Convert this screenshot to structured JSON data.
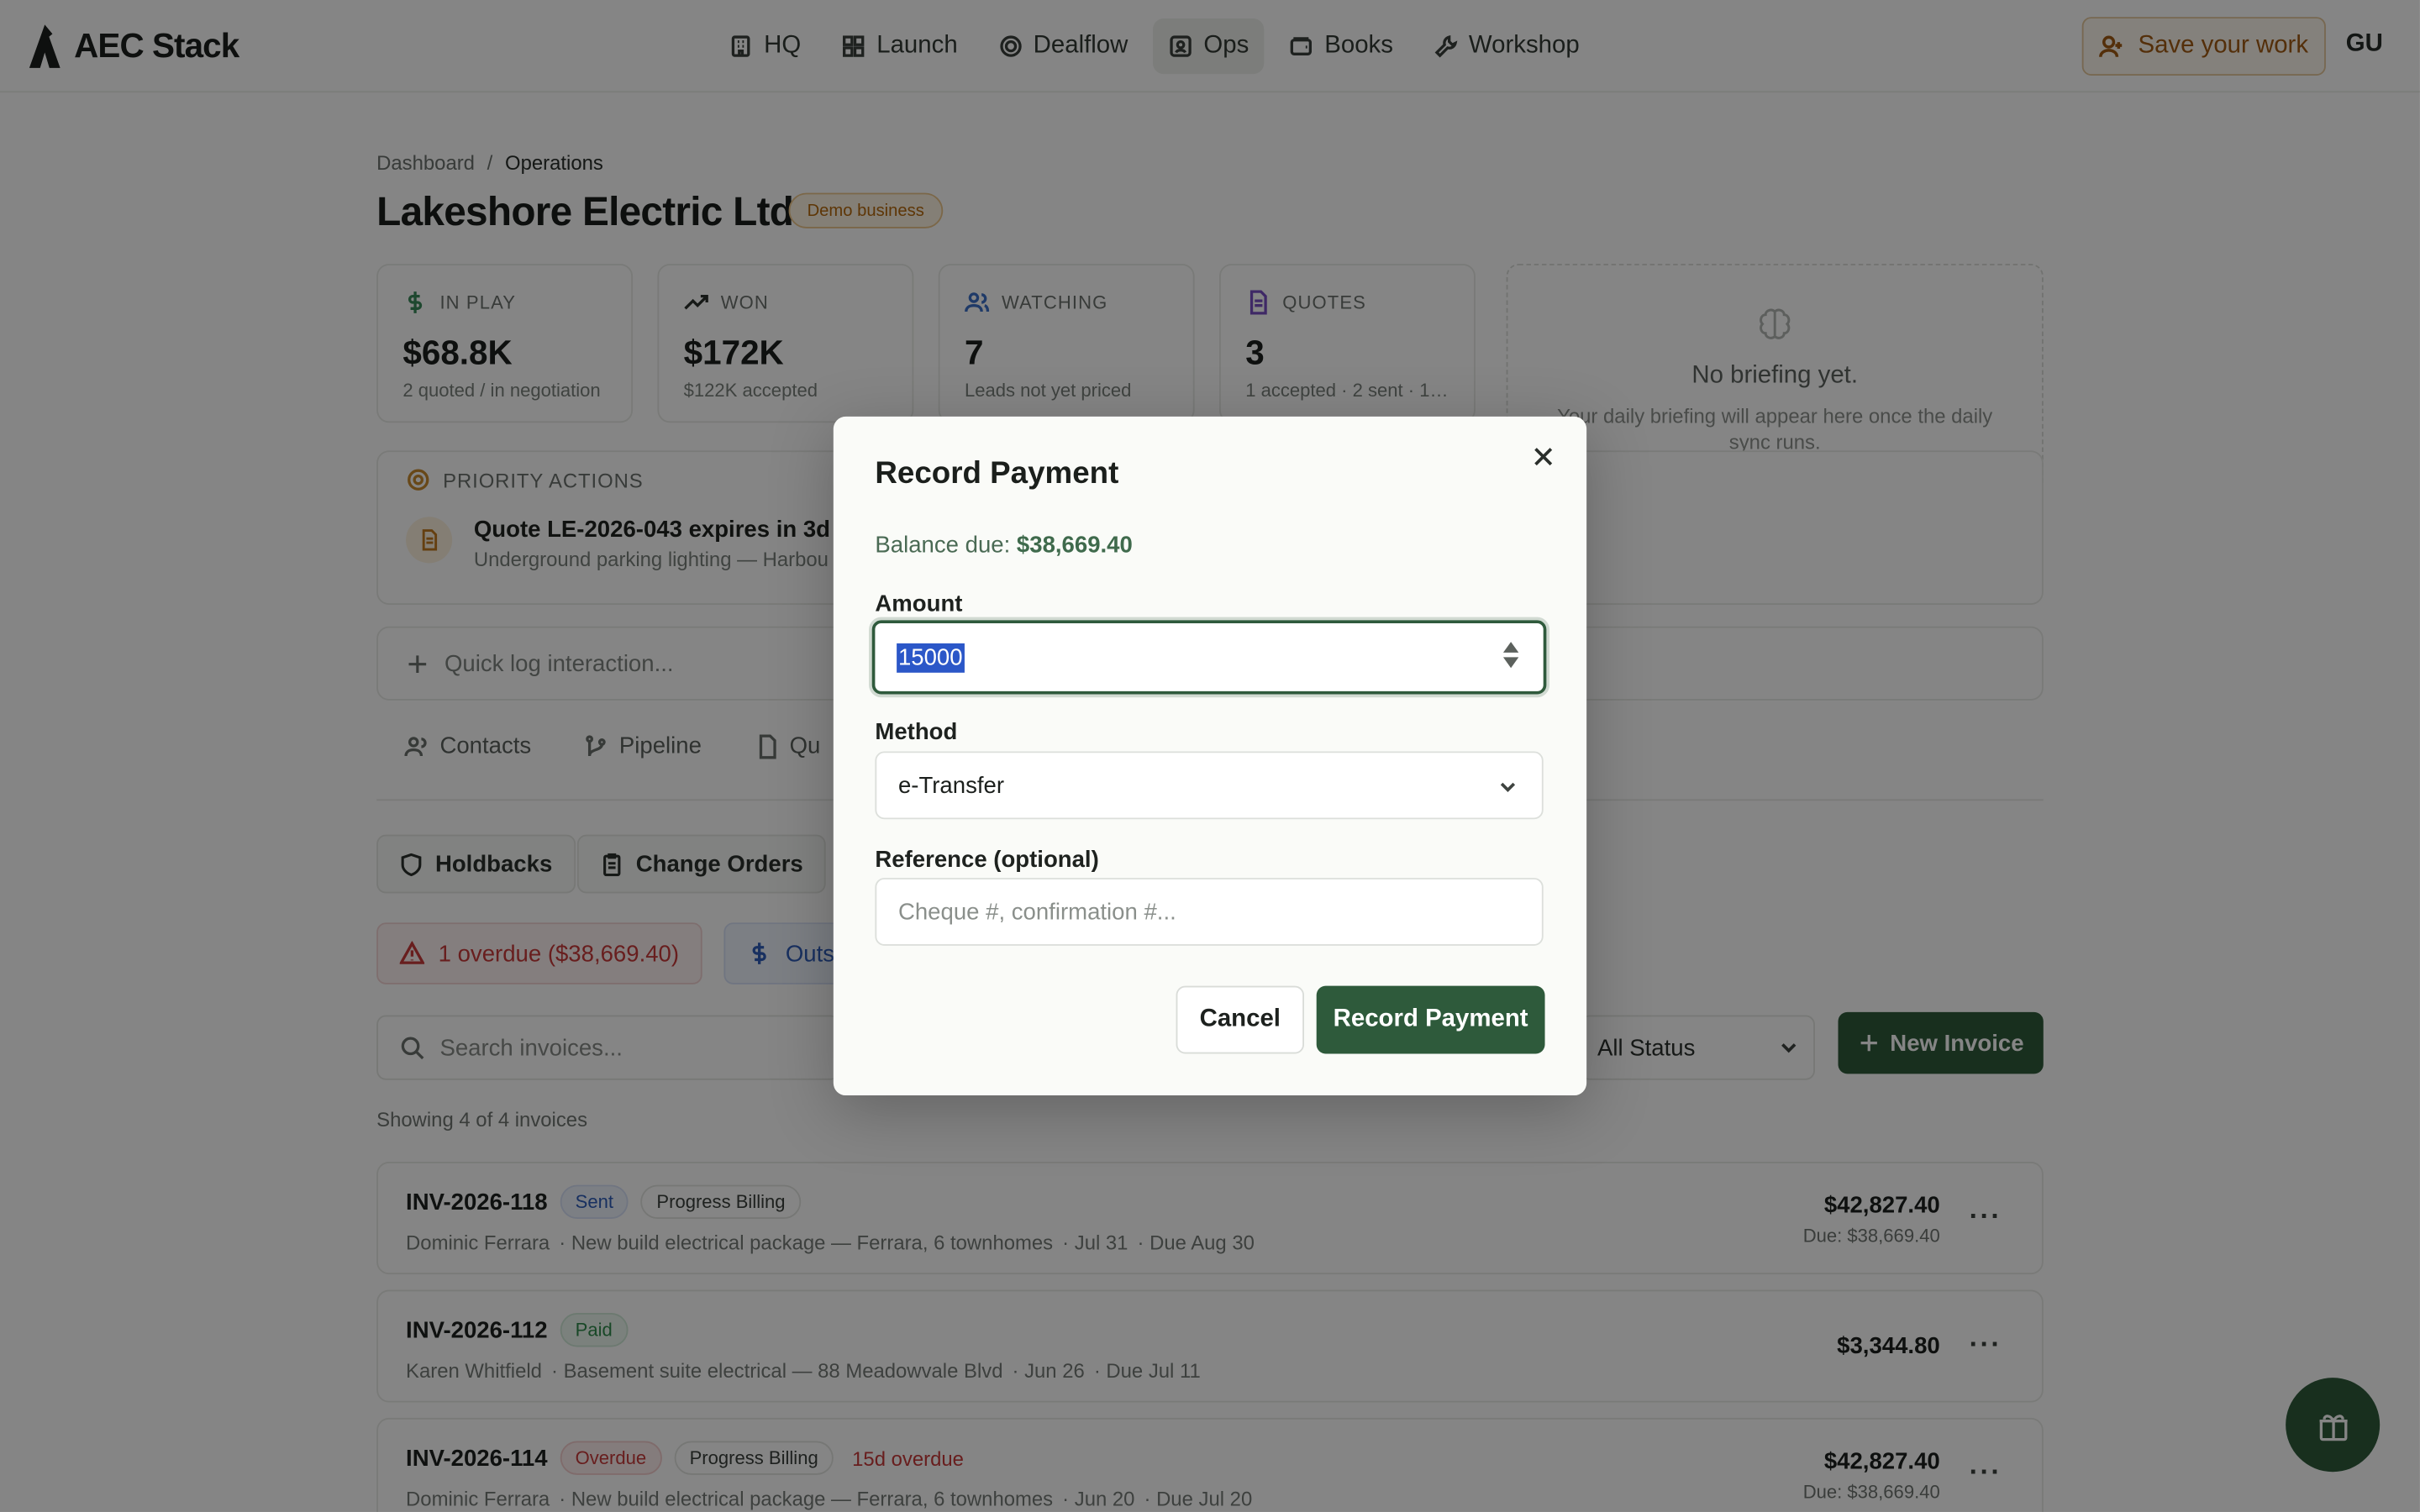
{
  "header": {
    "logo_text": "AEC Stack",
    "nav": [
      {
        "label": "HQ",
        "icon": "building-icon"
      },
      {
        "label": "Launch",
        "icon": "grid-icon"
      },
      {
        "label": "Dealflow",
        "icon": "target-icon"
      },
      {
        "label": "Ops",
        "icon": "contact-icon",
        "active": true
      },
      {
        "label": "Books",
        "icon": "wallet-icon"
      },
      {
        "label": "Workshop",
        "icon": "wrench-icon"
      }
    ],
    "save_label": "Save your work",
    "avatar_initials": "GU"
  },
  "breadcrumb": {
    "root": "Dashboard",
    "separator": "/",
    "current": "Operations"
  },
  "page": {
    "title": "Lakeshore Electric Ltd.",
    "badge": "Demo business"
  },
  "stats": [
    {
      "label": "IN PLAY",
      "value": "$68.8K",
      "sub": "2 quoted / in negotiation",
      "icon": "dollar-icon",
      "color": "#3a8a5a"
    },
    {
      "label": "WON",
      "value": "$172K",
      "sub": "$122K accepted",
      "icon": "trending-up-icon",
      "color": "#2b302c"
    },
    {
      "label": "WATCHING",
      "value": "7",
      "sub": "Leads not yet priced",
      "icon": "users-icon",
      "color": "#3d6fc7"
    },
    {
      "label": "QUOTES",
      "value": "3",
      "sub": "1 accepted · 2 sent · 1 d...",
      "icon": "file-icon",
      "color": "#7a4fc4"
    }
  ],
  "briefing": {
    "title": "No briefing yet.",
    "subtitle": "Your daily briefing will appear here once the daily sync runs."
  },
  "priority": {
    "heading": "PRIORITY ACTIONS",
    "item_title": "Quote LE-2026-043 expires in 3d",
    "item_sub": "Underground parking lighting — Harbou"
  },
  "quicklog": {
    "placeholder": "Quick log interaction..."
  },
  "tabs": [
    "Contacts",
    "Pipeline",
    "Qu"
  ],
  "subtabs": [
    "Holdbacks",
    "Change Orders"
  ],
  "alerts": {
    "overdue": "1 overdue ($38,669.40)",
    "outstanding": "Outs"
  },
  "toolbar": {
    "search_placeholder": "Search invoices...",
    "status_value": "All Status",
    "new_invoice": "New Invoice"
  },
  "invoices_summary": "Showing 4 of 4 invoices",
  "invoices": [
    {
      "number": "INV-2026-118",
      "status": "Sent",
      "type": "Progress Billing",
      "overdue": "",
      "client": "Dominic Ferrara",
      "project": "· New build electrical package — Ferrara, 6 townhomes",
      "date": "· Jul 31",
      "due": "· Due Aug 30",
      "amount": "$42,827.40",
      "due_amount": "Due: $38,669.40"
    },
    {
      "number": "INV-2026-112",
      "status": "Paid",
      "type": "",
      "overdue": "",
      "client": "Karen Whitfield",
      "project": "· Basement suite electrical — 88 Meadowvale Blvd",
      "date": "· Jun 26",
      "due": "· Due Jul 11",
      "amount": "$3,344.80",
      "due_amount": ""
    },
    {
      "number": "INV-2026-114",
      "status": "Overdue",
      "type": "Progress Billing",
      "overdue": "15d overdue",
      "client": "Dominic Ferrara",
      "project": "· New build electrical package — Ferrara, 6 townhomes",
      "date": "· Jun 20",
      "due": "· Due Jul 20",
      "amount": "$42,827.40",
      "due_amount": "Due: $38,669.40"
    }
  ],
  "modal": {
    "title": "Record Payment",
    "balance_label": "Balance due:",
    "balance_value": "$38,669.40",
    "amount_label": "Amount",
    "amount_value": "15000",
    "method_label": "Method",
    "method_value": "e-Transfer",
    "reference_label": "Reference (optional)",
    "reference_placeholder": "Cheque #, confirmation #...",
    "cancel": "Cancel",
    "submit": "Record Payment"
  },
  "colors": {
    "brand_green": "#2e5a3b",
    "overdue_red": "#c73b3b",
    "warning_amber": "#b5680c"
  }
}
